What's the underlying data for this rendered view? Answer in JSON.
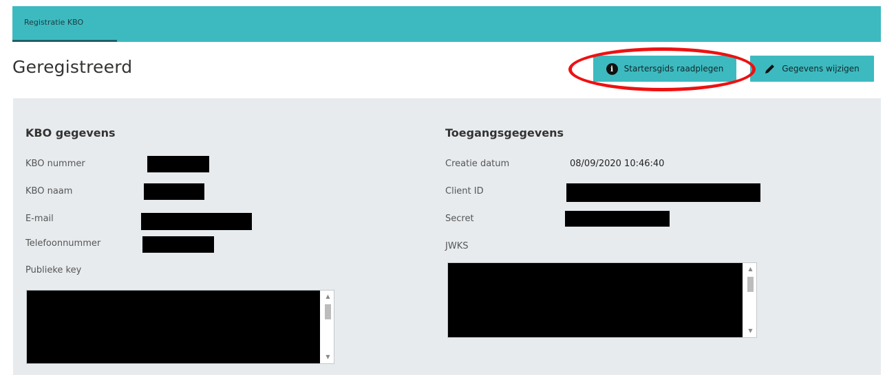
{
  "tabs": [
    {
      "label": "Registratie KBO",
      "active": true
    }
  ],
  "page": {
    "title": "Geregistreerd"
  },
  "actions": {
    "guide_label": "Startersgids raadplegen",
    "guide_icon": "info-circle-icon",
    "edit_label": "Gegevens wijzigen",
    "edit_icon": "pencil-icon"
  },
  "kbo": {
    "title": "KBO gegevens",
    "fields": [
      {
        "label": "KBO nummer",
        "value": ""
      },
      {
        "label": "KBO naam",
        "value": ""
      },
      {
        "label": "E-mail",
        "value": ""
      },
      {
        "label": "Telefoonnummer",
        "value": ""
      }
    ],
    "public_key_label": "Publieke key"
  },
  "access": {
    "title": "Toegangsgegevens",
    "creation_label": "Creatie datum",
    "creation_value": "08/09/2020 10:46:40",
    "client_id_label": "Client ID",
    "secret_label": "Secret",
    "jwks_label": "JWKS"
  },
  "colors": {
    "accent": "#3dbac0",
    "panel": "#e8ebee",
    "highlight": "#ee1111"
  }
}
